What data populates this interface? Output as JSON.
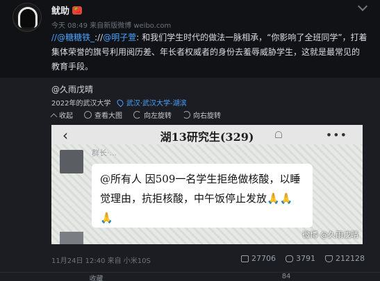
{
  "post": {
    "username": "鱿助",
    "badge": "🍓",
    "time_source": "今天 08:49 来自新版微博 weibo.com",
    "mention1": "//@糖糖铁_",
    "sep": "://",
    "mention2": "@明子萱",
    "text_part": ": 和我们学生时代的做法一脉相承，“你影响了全班同学”，打着集体荣誉的旗号利用阅历差、年长者权威者的身份去羞辱威胁学生，这就是最常见的教育手段。"
  },
  "repost": {
    "author": "@久雨戊晴",
    "school": "2022年的武汉大学",
    "location": "武汉·武汉大学-湖滨",
    "toolbar": {
      "collapse": "收起",
      "view_large": "查看大图",
      "rotate_left": "向左旋转",
      "rotate_right": "向右旋转"
    },
    "image": {
      "back": "‹",
      "title": "湖13研究生(329)",
      "dots": "•••",
      "sender_name": "群长·...",
      "message": "@所有人 因509一名学生拒绝做核酸，以睡觉理由，抗拒核酸，中午饭停止发放🙏🙏🙏",
      "watermark": "微博 @久雨戊晴"
    },
    "footer_time": "11月24日 12:40 来自 小米10S",
    "stats": {
      "reposts": "27706",
      "comments": "3791",
      "likes": "212128"
    }
  },
  "bottom_bar": {
    "collapse": "收藏",
    "count": "84"
  }
}
